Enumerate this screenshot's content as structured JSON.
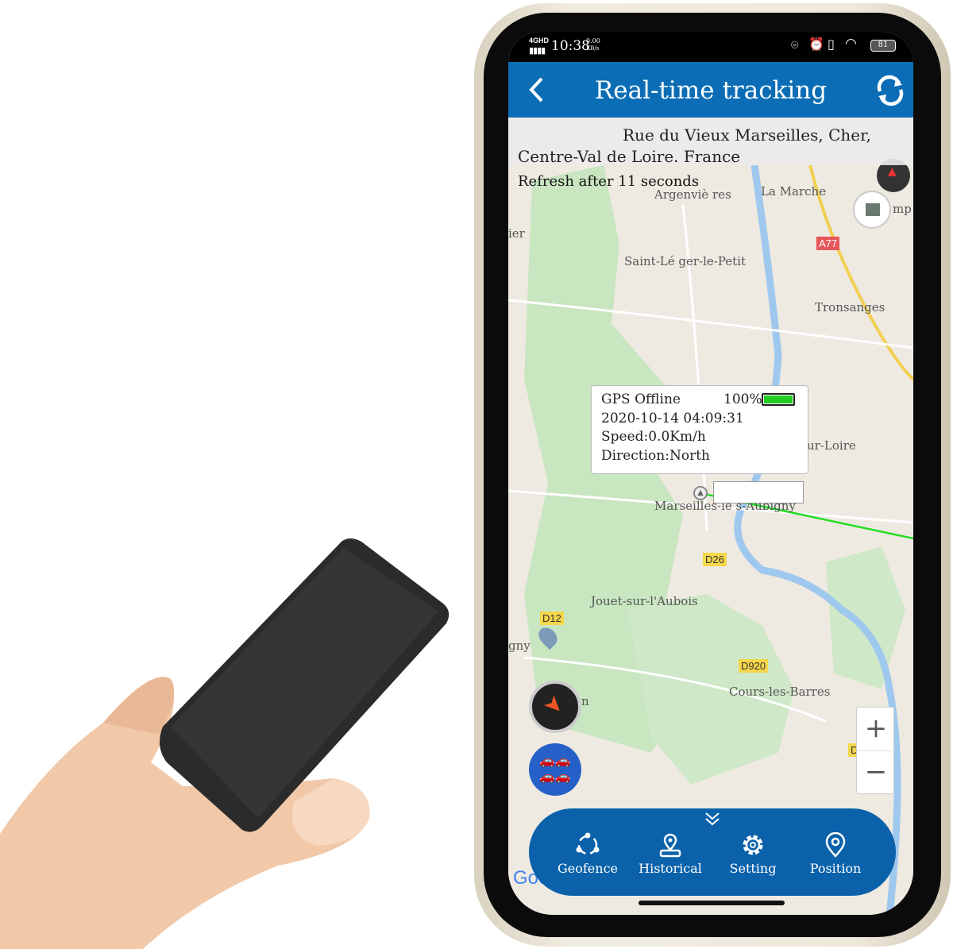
{
  "status_bar": {
    "network": "4GHD",
    "time": "10:38",
    "speed": "0.00",
    "speed_unit": "KB/s",
    "battery": "81"
  },
  "header": {
    "title": "Real-time tracking",
    "back_icon": "chevron-left-icon",
    "refresh_icon": "refresh-icon"
  },
  "address": {
    "line1": "Rue du Vieux Marseilles, Cher,",
    "line2": "Centre-Val de Loire. France",
    "refresh": "Refresh after 11 seconds"
  },
  "map": {
    "places": [
      "Argenviè res",
      "La Marche",
      "ier",
      "Saint-Lé ger-le-Petit",
      "Tronsanges",
      "ur-Loire",
      "Marseilles-lè s-Aubigny",
      "Jouet-sur-l'Aubois",
      "gny",
      "Cours-les-Barres",
      "n",
      "mp"
    ],
    "roads": [
      "A77",
      "D26",
      "D12",
      "D920",
      "D"
    ],
    "google": "Google",
    "zoom_in": "+",
    "zoom_out": "−"
  },
  "popup": {
    "status": "GPS Offline",
    "battery": "100%",
    "battery_level": 1.0,
    "datetime": "2020-10-14 04:09:31",
    "speed": "Speed:0.0Km/h",
    "direction": "Direction:North"
  },
  "bottom_nav": [
    {
      "label": "Geofence",
      "icon": "geofence-icon"
    },
    {
      "label": "Historical",
      "icon": "historical-icon"
    },
    {
      "label": "Setting",
      "icon": "gear-icon"
    },
    {
      "label": "Position",
      "icon": "location-pin-icon"
    }
  ],
  "colors": {
    "header": "#0a6db5",
    "nav": "#0b62ab",
    "route": "#22dd22",
    "battery": "#22cc22"
  }
}
